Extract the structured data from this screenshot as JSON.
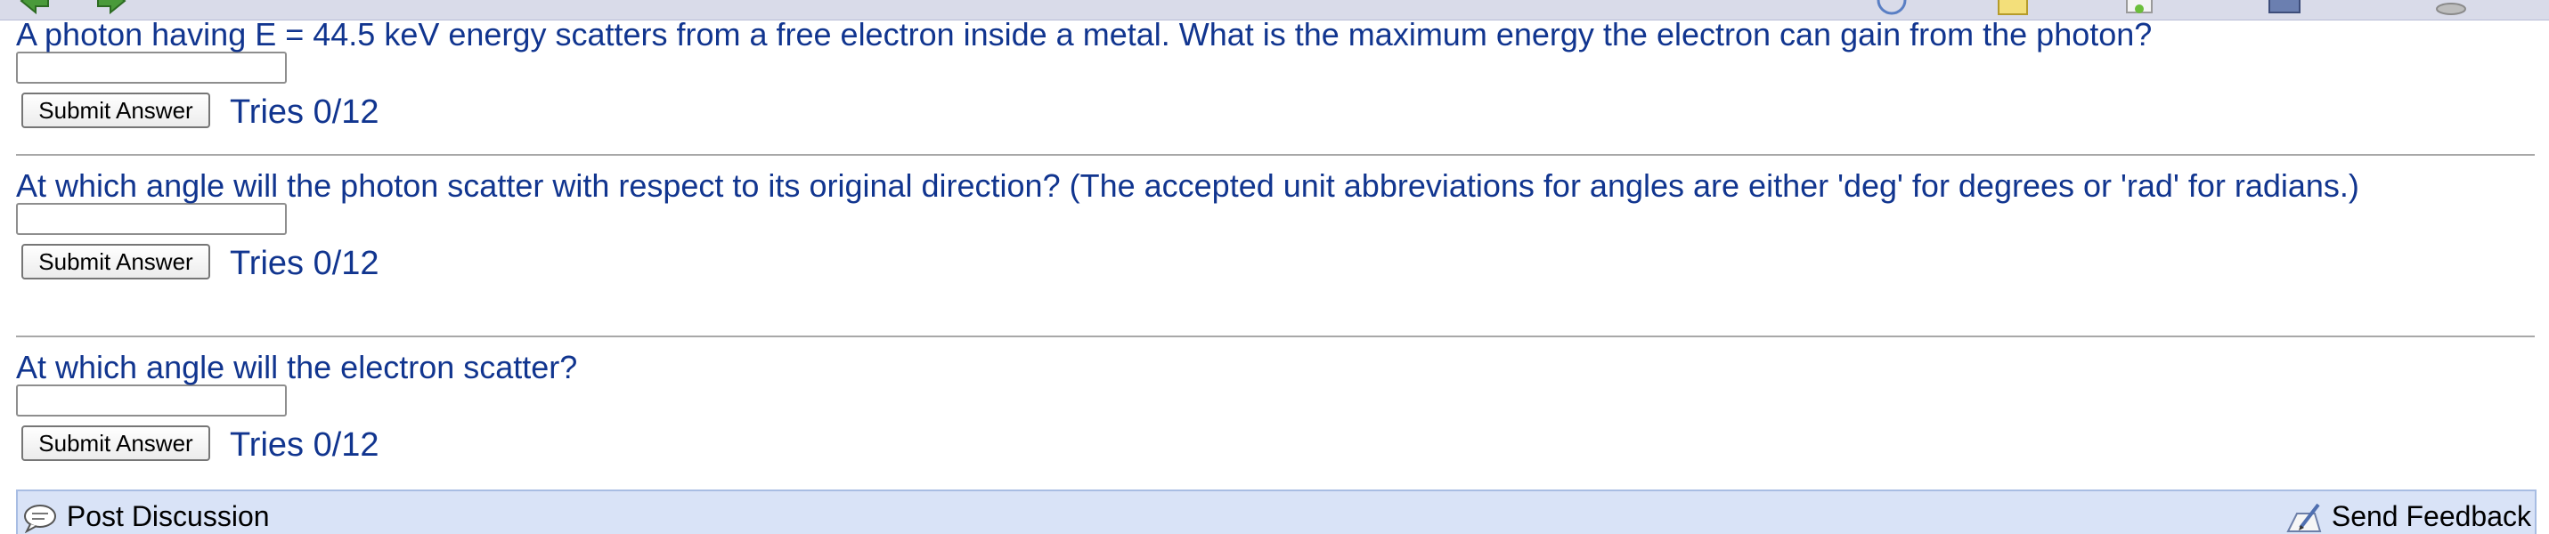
{
  "questions": [
    {
      "text": "A photon having E = 44.5 keV energy scatters from a free electron inside a metal. What is the maximum energy the electron can gain from the photon?",
      "answer_value": "",
      "submit_label": "Submit Answer",
      "tries": "Tries 0/12"
    },
    {
      "text": "At which angle will the photon scatter with respect to its original direction? (The accepted unit abbreviations for angles are either 'deg' for degrees or 'rad' for radians.)",
      "answer_value": "",
      "submit_label": "Submit Answer",
      "tries": "Tries 0/12"
    },
    {
      "text": "At which angle will the electron scatter?",
      "answer_value": "",
      "submit_label": "Submit Answer",
      "tries": "Tries 0/12"
    }
  ],
  "footer": {
    "post_discussion_label": "Post Discussion",
    "send_feedback_label": "Send Feedback"
  },
  "icons": {
    "nav_back": "arrow-left-icon",
    "nav_forward": "arrow-right-icon",
    "post_discussion": "speech-bubble-icon",
    "send_feedback": "pen-paper-icon"
  },
  "colors": {
    "question_text": "#11358f",
    "footer_bg": "#d9e3f7",
    "nav_arrow": "#3c8d2f"
  }
}
